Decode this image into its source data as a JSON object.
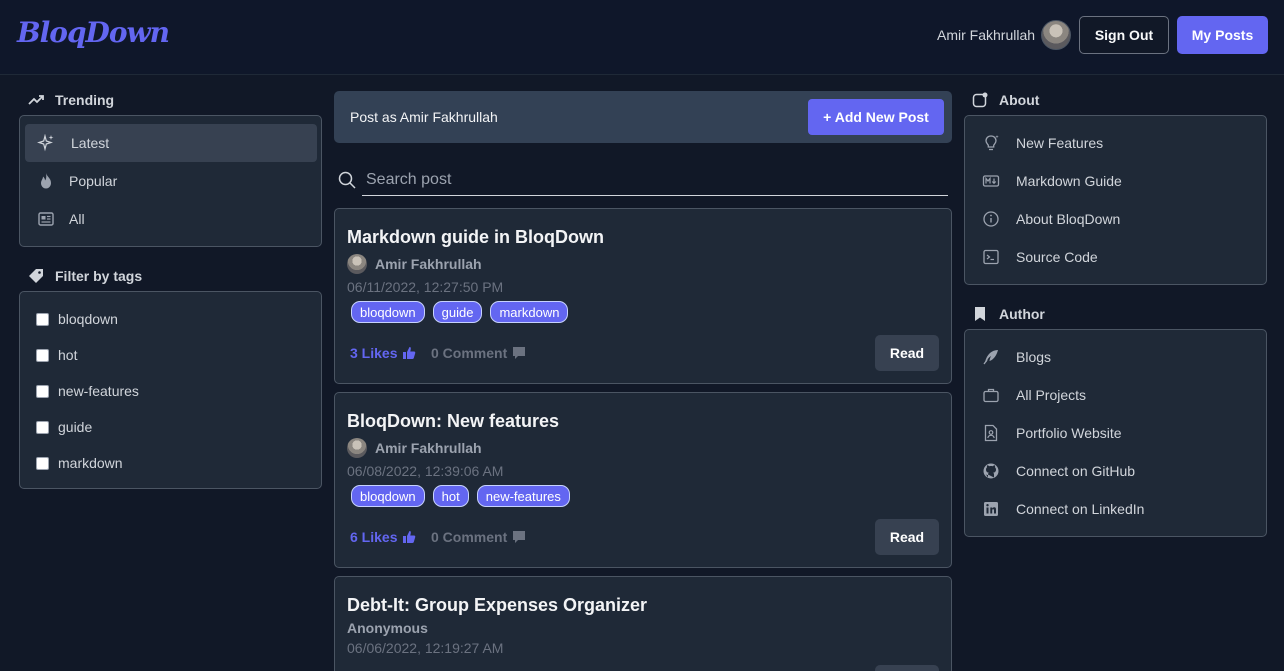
{
  "header": {
    "logo": "BloqDown",
    "user_name": "Amir Fakhrullah",
    "sign_out": "Sign Out",
    "my_posts": "My Posts"
  },
  "left": {
    "trending_title": "Trending",
    "trending_items": [
      {
        "label": "Latest",
        "icon": "sparkles-icon"
      },
      {
        "label": "Popular",
        "icon": "fire-icon"
      },
      {
        "label": "All",
        "icon": "newspaper-icon"
      }
    ],
    "filter_title": "Filter by tags",
    "tags": [
      "bloqdown",
      "hot",
      "new-features",
      "guide",
      "markdown"
    ]
  },
  "center": {
    "post_as": "Post as Amir Fakhrullah",
    "add_post": "+ Add New Post",
    "search_placeholder": "Search post",
    "posts": [
      {
        "title": "Markdown guide in BloqDown",
        "author": "Amir Fakhrullah",
        "date": "06/11/2022, 12:27:50 PM",
        "tags": [
          "bloqdown",
          "guide",
          "markdown"
        ],
        "likes": "3 Likes",
        "comments": "0 Comment",
        "read": "Read"
      },
      {
        "title": "BloqDown: New features",
        "author": "Amir Fakhrullah",
        "date": "06/08/2022, 12:39:06 AM",
        "tags": [
          "bloqdown",
          "hot",
          "new-features"
        ],
        "likes": "6 Likes",
        "comments": "0 Comment",
        "read": "Read"
      },
      {
        "title": "Debt-It: Group Expenses Organizer",
        "author": "Anonymous",
        "date": "06/06/2022, 12:19:27 AM"
      }
    ]
  },
  "right": {
    "about_title": "About",
    "about_items": [
      "New Features",
      "Markdown Guide",
      "About BloqDown",
      "Source Code"
    ],
    "author_title": "Author",
    "author_items": [
      "Blogs",
      "All Projects",
      "Portfolio Website",
      "Connect on GitHub",
      "Connect on LinkedIn"
    ]
  },
  "colors": {
    "accent": "#6366f1",
    "background": "#111827",
    "panel": "#1f2937"
  }
}
